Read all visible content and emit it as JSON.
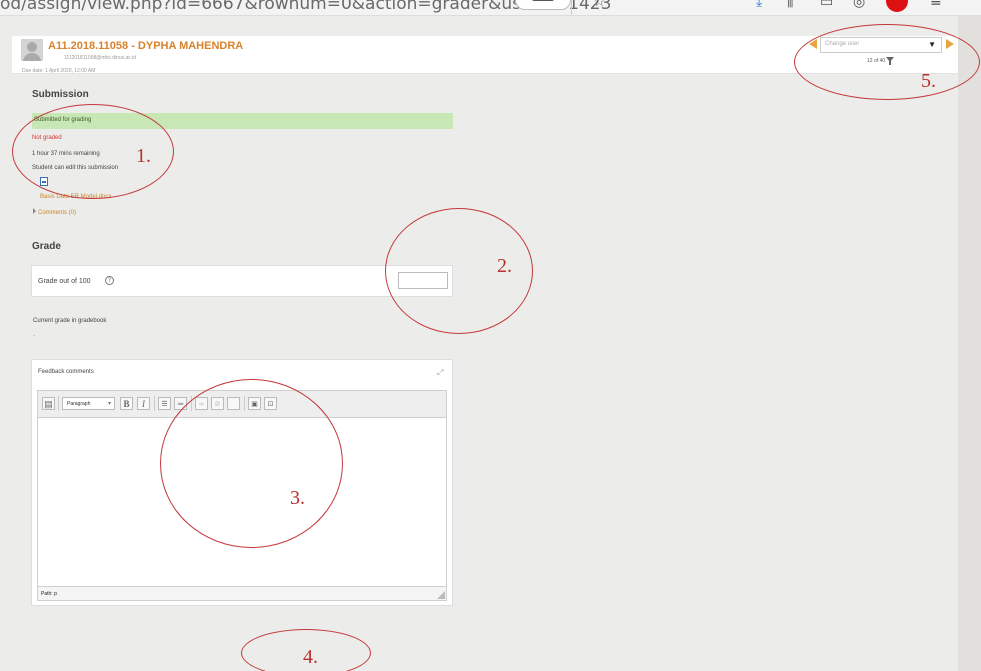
{
  "browser": {
    "url_fragment": "od/assign/view.php?id=6667&rownum=0&action=grader&userid=1423"
  },
  "header": {
    "student_name": "A11.2018.11058 - DYPHA MAHENDRA",
    "student_email": "111201811058@mhs.dinus.ac.id",
    "due_date": "Due date: 1 April 2020, 12:00 AM",
    "change_user_placeholder": "Change user",
    "counter": "12 of 40"
  },
  "submission": {
    "title": "Submission",
    "status": "Submitted for grading",
    "grading_status": "Not graded",
    "time_remaining": "1 hour 37 mins remaining",
    "edit_note": "Student can edit this submission",
    "file_name": "Basis Data ER Model.docx",
    "comments": "Comments (0)"
  },
  "grade": {
    "title": "Grade",
    "label": "Grade out of 100",
    "input_value": "",
    "current_grade_label": "Current grade in gradebook",
    "current_grade_value": "-"
  },
  "feedback": {
    "label": "Feedback comments",
    "format_select": "Paragraph",
    "path": "Path: p"
  },
  "annotations": {
    "a1": "1.",
    "a2": "2.",
    "a3": "3.",
    "a4": "4.",
    "a5": "5."
  },
  "colors": {
    "accent": "#d9822b",
    "status_green": "#c7e8b4",
    "error_red": "#dd3333",
    "annotation_red": "#c4393b"
  }
}
